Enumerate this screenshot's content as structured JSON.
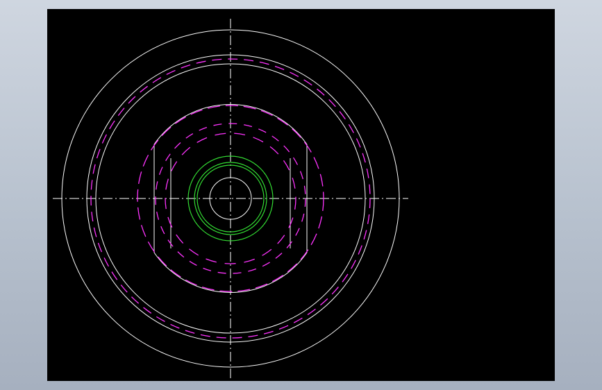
{
  "canvas": {
    "background_color": "#000000",
    "page_background": "#b7c1ce"
  },
  "drawing": {
    "view": "front-view",
    "colors": {
      "outline": "#ffffff",
      "hidden": "#ff33ff",
      "green": "#33dd33"
    },
    "line_types": {
      "centerline": "dash-dot",
      "hidden": "dashed",
      "outline": "continuous"
    }
  }
}
